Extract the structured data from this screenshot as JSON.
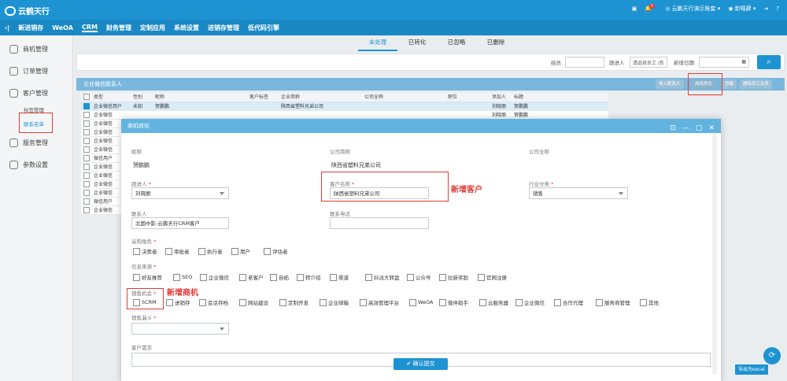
{
  "app": {
    "brand": "云鹤天行",
    "top_right": [
      "云鹏天行演示账套",
      "新嘻藓"
    ]
  },
  "menu": {
    "items": [
      "新进销存",
      "WeOA",
      "CRM",
      "财务管理",
      "定制应用",
      "系统设置",
      "进销存管理",
      "低代码引擎"
    ],
    "active": "CRM"
  },
  "sidebar": {
    "items": [
      "商机管理",
      "订单管理",
      "客户管理",
      "服务管理",
      "参数设置"
    ],
    "sub_items": [
      "标签管理",
      "联系名单"
    ]
  },
  "tabs": {
    "items": [
      "未处理",
      "已转化",
      "已忽略",
      "已删除"
    ],
    "active": "未处理"
  },
  "filter": {
    "labels": {
      "clerk": "经员",
      "follower": "跟进人",
      "date": "新增日期"
    },
    "follower_placeholder": "请选择员工 /负"
  },
  "grid": {
    "title": "企业微信联系人",
    "buttons": [
      "导入联系人",
      "商机转化",
      "忽略",
      "删除员工关系"
    ],
    "columns": [
      "类型",
      "性别",
      "昵称",
      "客户标签",
      "企业简称",
      "公司全称",
      "职位",
      "添加人",
      "标题"
    ],
    "rows": [
      {
        "type": "企业微信用户",
        "gender": "未知",
        "nick": "贺鹏鹏",
        "corp": "陕西省塑料兄弟公司",
        "adder": "刘晓丽",
        "title": "贺鹏鹏",
        "checked": true
      },
      {
        "type": "企业微信",
        "gender": "",
        "nick": "",
        "corp": "",
        "adder": "刘晓丽",
        "title": "贺鹏鹏",
        "checked": false
      },
      {
        "type": "企业微信",
        "checked": false
      },
      {
        "type": "企业微信",
        "checked": false
      },
      {
        "type": "企业微信",
        "checked": false
      },
      {
        "type": "企业微信",
        "checked": false
      },
      {
        "type": "微信用户",
        "checked": false
      },
      {
        "type": "企业微信",
        "checked": false
      },
      {
        "type": "企业微信",
        "checked": false
      },
      {
        "type": "企业微信",
        "checked": false
      },
      {
        "type": "企业微信",
        "checked": false
      },
      {
        "type": "微信用户",
        "checked": false
      },
      {
        "type": "企业微信",
        "checked": false
      }
    ]
  },
  "export_label": "导出为excel",
  "modal": {
    "title": "商机转化",
    "nick_label": "昵称",
    "nick": "贺鹏鹏",
    "short_label": "公司简称",
    "short": "陕西省塑料兄弟公司",
    "full_label": "公司全称",
    "follower_label": "跟进人",
    "follower": "刘晓丽",
    "cust_label": "客户名称",
    "cust": "陕西省塑料兄弟公司",
    "industry_label": "行业分类",
    "industry": "销售",
    "contact_label": "联系人",
    "contact": "北国中影-云鹏天行CRM客户",
    "phone_label": "联系电话",
    "role_label": "采购角色",
    "roles": [
      "决策者",
      "审批者",
      "执行者",
      "用户",
      "评估者"
    ],
    "source_label": "信息来源",
    "sources": [
      "好友推荐",
      "SEO",
      "企业微信",
      "老客户",
      "自拓",
      "转介绍",
      "渠道",
      "抖派大转盘",
      "公众号",
      "拉新奖励",
      "官网注册"
    ],
    "opp_label": "销售机会",
    "opps": [
      "SCRM",
      "进销存",
      "会话存档",
      "网站建设",
      "定制开发",
      "企业邮箱",
      "高效管理平台",
      "WeOA",
      "微伴助手",
      "云服务器",
      "企业微信",
      "合作代理",
      "服务商管理",
      "其他"
    ],
    "stage_label": "销售漏斗",
    "need_label": "客户需求",
    "submit": "确认提交"
  },
  "annotations": {
    "new_customer": "新增客户",
    "new_opportunity": "新增商机"
  },
  "colors": {
    "primary": "#1d93d2",
    "annotation": "#e53935"
  }
}
